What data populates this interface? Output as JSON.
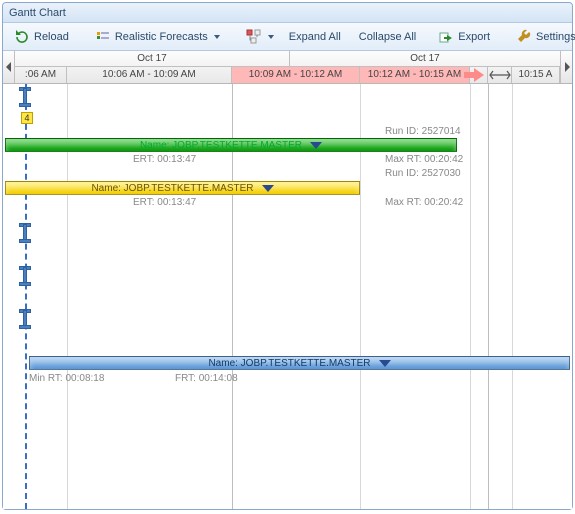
{
  "window": {
    "title": "Gantt Chart"
  },
  "toolbar": {
    "reload": "Reload",
    "forecasts": "Realistic Forecasts",
    "expand_all": "Expand All",
    "collapse_all": "Collapse All",
    "export": "Export",
    "settings": "Settings"
  },
  "timeline": {
    "day1": "Oct 17",
    "day2": "Oct 17",
    "slots": {
      "s0": ":06 AM",
      "s1": "10:06 AM - 10:09 AM",
      "s2": "10:09 AM - 10:12 AM",
      "s3": "10:12 AM - 10:15 AM",
      "s4": "10:15 A"
    }
  },
  "badge": "4",
  "rows": {
    "run1": "Run ID: 2527014",
    "bar1": "Name: JOBP.TESTKETTE.MASTER",
    "ert1": "ERT: 00:13:47",
    "max1": "Max RT: 00:20:42",
    "run2": "Run ID: 2527030",
    "bar2": "Name: JOBP.TESTKETTE.MASTER",
    "ert2": "ERT: 00:13:47",
    "max2": "Max RT: 00:20:42",
    "bar3": "Name: JOBP.TESTKETTE.MASTER",
    "min3": "Min RT: 00:08:18",
    "frt3": "FRT: 00:14:08"
  }
}
